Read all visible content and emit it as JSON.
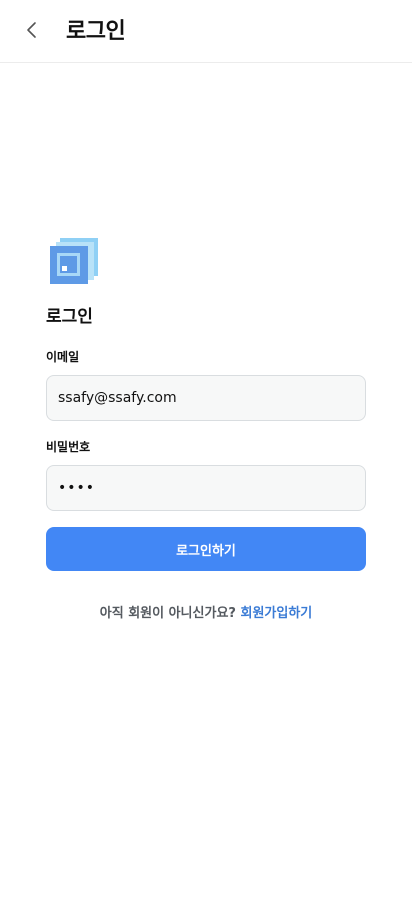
{
  "header": {
    "title": "로그인",
    "back_icon": "chevron-left-icon"
  },
  "logo": {
    "icon": "stacked-squares-logo",
    "colors": {
      "back": "#8fd0f5",
      "front": "#5e9ae6",
      "inner": "#a8d8f7",
      "core": "#ffffff"
    }
  },
  "form": {
    "title": "로그인",
    "email": {
      "label": "이메일",
      "value": "ssafy@ssafy.com"
    },
    "password": {
      "label": "비밀번호",
      "value": "••••"
    },
    "submit_label": "로그인하기"
  },
  "signup": {
    "prompt": "아직 회원이 아니신가요?",
    "link_label": "회원가입하기"
  },
  "colors": {
    "accent": "#4287f5",
    "link": "#3a7bd5"
  }
}
